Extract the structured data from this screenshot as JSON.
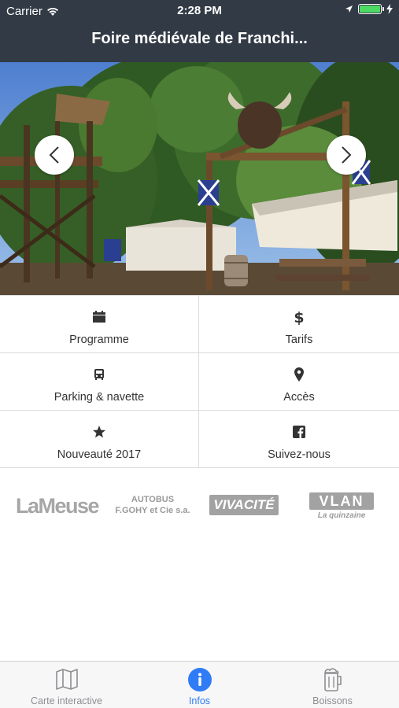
{
  "status_bar": {
    "carrier": "Carrier",
    "time": "2:28 PM",
    "battery_color": "#4cd964"
  },
  "nav": {
    "title": "Foire médiévale de Franchi..."
  },
  "hero": {
    "prev_icon": "chevron-left-icon",
    "next_icon": "chevron-right-icon"
  },
  "menu": [
    {
      "label": "Programme",
      "icon": "calendar-icon"
    },
    {
      "label": "Tarifs",
      "icon": "dollar-icon"
    },
    {
      "label": "Parking & navette",
      "icon": "bus-icon"
    },
    {
      "label": "Accès",
      "icon": "map-pin-icon"
    },
    {
      "label": "Nouveauté 2017",
      "icon": "star-icon"
    },
    {
      "label": "Suivez-nous",
      "icon": "facebook-icon"
    }
  ],
  "sponsors": {
    "lameuse": "LaMeuse",
    "autobus_line1": "AUTOBUS",
    "autobus_line2": "F.GOHY et Cie s.a.",
    "vivacite": "VIVACITÉ",
    "vlan": "VLAN",
    "vlan_sub": "La quinzaine"
  },
  "tabs": [
    {
      "label": "Carte interactive",
      "icon": "map-icon",
      "active": false
    },
    {
      "label": "Infos",
      "icon": "info-icon",
      "active": true
    },
    {
      "label": "Boissons",
      "icon": "beer-icon",
      "active": false
    }
  ],
  "colors": {
    "nav_bg": "#323a45",
    "accent": "#2f7cf6",
    "tab_inactive": "#8e8e93"
  }
}
